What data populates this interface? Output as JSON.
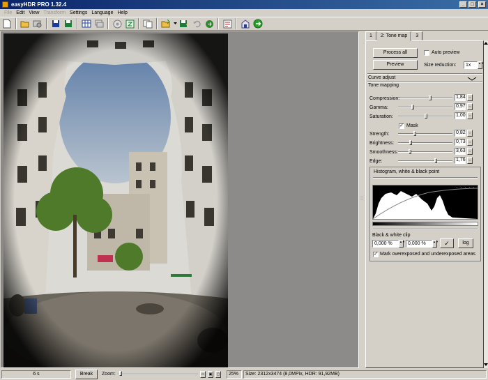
{
  "window": {
    "title": "easyHDR PRO 1.32.4",
    "min": "_",
    "max": "□",
    "close": "×"
  },
  "menu": [
    {
      "label": "File",
      "enabled": false
    },
    {
      "label": "Edit",
      "enabled": true
    },
    {
      "label": "View",
      "enabled": true
    },
    {
      "label": "Transform",
      "enabled": false
    },
    {
      "label": "Settings",
      "enabled": true
    },
    {
      "label": "Language",
      "enabled": true
    },
    {
      "label": "Help",
      "enabled": true
    }
  ],
  "tabs": [
    "1",
    "2: Tone map",
    "3"
  ],
  "tone_map": {
    "process_all": "Process all",
    "auto_preview": "Auto preview",
    "preview": "Preview",
    "size_reduction_label": "Size reduction:",
    "size_reduction_value": "1x",
    "curve_adjust": "Curve adjust",
    "tone_mapping": "Tone mapping",
    "mask": "Mask",
    "sliders": [
      {
        "label": "Compression:",
        "value": "1,84",
        "pos": 0.6
      },
      {
        "label": "Gamma:",
        "value": "0,97",
        "pos": 0.26
      },
      {
        "label": "Saturation:",
        "value": "1,00",
        "pos": 0.52
      },
      {
        "label": "Strength:",
        "value": "0,82",
        "pos": 0.3
      },
      {
        "label": "Brightness:",
        "value": "0,73",
        "pos": 0.22
      },
      {
        "label": "Smoothness:",
        "value": "3,63",
        "pos": 0.2
      },
      {
        "label": "Edge:",
        "value": "1,76",
        "pos": 0.7
      }
    ]
  },
  "histogram": {
    "title": "Histogram, white & black point",
    "bw_clip_label": "Black & white clip",
    "black_clip": "0,000 %",
    "white_clip": "0,000 %",
    "ok": "✓",
    "log": "log",
    "mark_label": "Mark overexposed and underexposed areas"
  },
  "status": {
    "time": "6 s",
    "break": "Break",
    "zoom_label": "Zoom:",
    "zoom_value": "25%",
    "size_info": "Size: 2312x3474 (8,0MPix, HDR: 91,92MB)"
  }
}
